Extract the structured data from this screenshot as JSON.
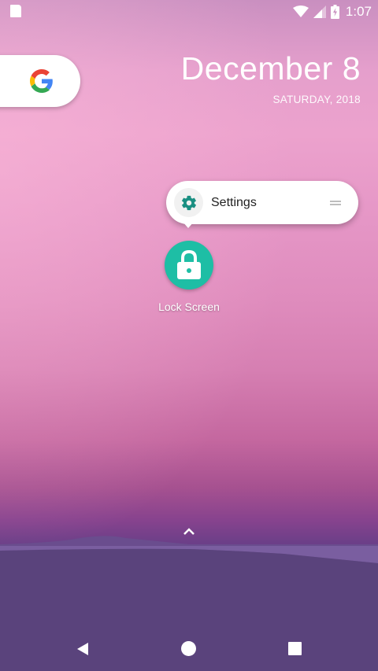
{
  "status_bar": {
    "time": "1:07",
    "icons": [
      "sd-card-icon",
      "wifi-icon",
      "signal-icon",
      "battery-charging-icon"
    ]
  },
  "google_widget": {
    "icon": "google-g-icon"
  },
  "date_widget": {
    "date": "December 8",
    "day": "SATURDAY, 2018"
  },
  "shortcut_popup": {
    "items": [
      {
        "label": "Settings",
        "icon": "gear-icon"
      }
    ]
  },
  "app": {
    "label": "Lock Screen",
    "icon": "lock-icon",
    "icon_color": "#1ebea5"
  },
  "app_drawer": {
    "icon": "chevron-up-icon"
  },
  "nav_bar": {
    "icons": [
      "back-icon",
      "home-icon",
      "recents-icon"
    ]
  }
}
